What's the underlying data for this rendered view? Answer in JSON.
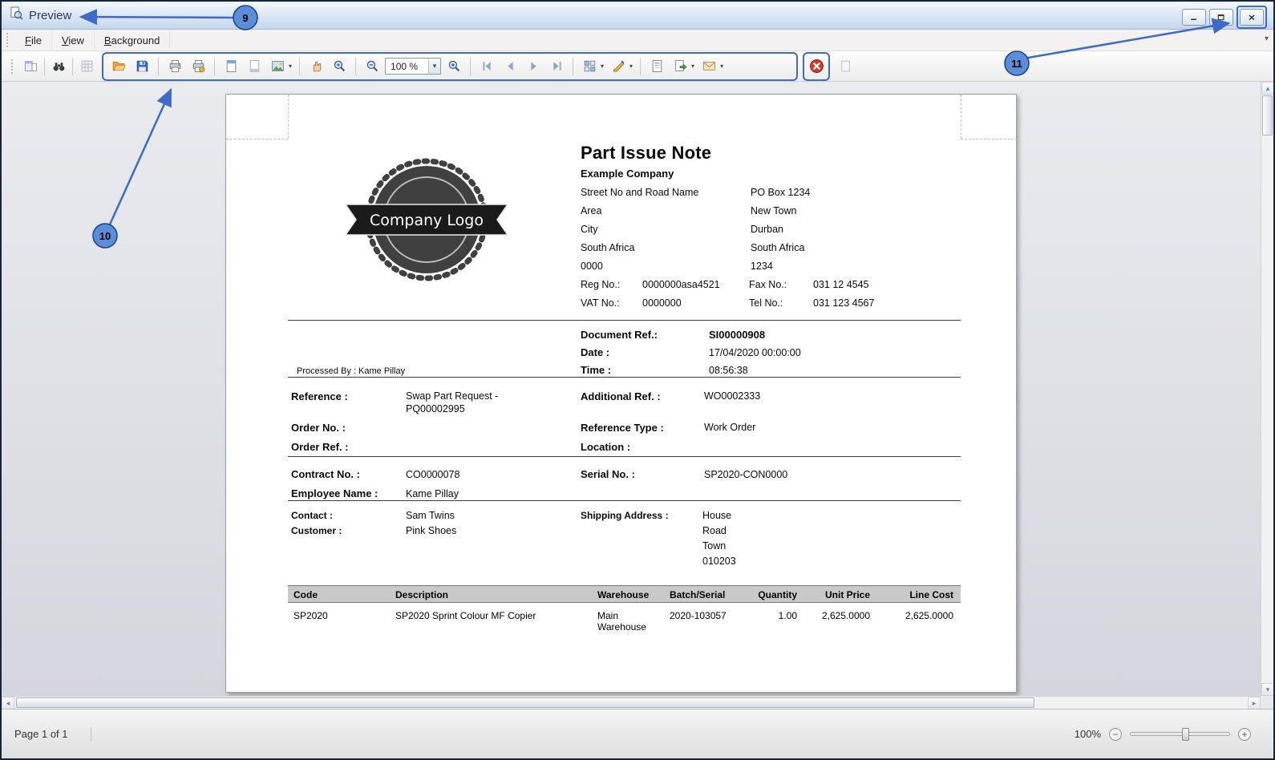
{
  "window": {
    "title": "Preview"
  },
  "menu": {
    "items": [
      "File",
      "View",
      "Background"
    ]
  },
  "toolbar": {
    "zoom_value": "100 %",
    "icons": [
      "dock-panels",
      "find",
      "grid",
      "open",
      "save",
      "print",
      "print-direct",
      "page-header",
      "page-footer",
      "scale-picture",
      "hand-tool",
      "zoom-tool",
      "zoom-out",
      "zoom-in",
      "first-page",
      "previous-page",
      "next-page",
      "last-page",
      "multiple-pages",
      "watermark",
      "document-map",
      "export",
      "email",
      "close-preview"
    ]
  },
  "annotations": {
    "callout_9": "9",
    "callout_10": "10",
    "callout_11": "11"
  },
  "colors": {
    "annotation_blue": "#3d6bc6",
    "close_red": "#d23a2e"
  },
  "statusbar": {
    "page_info": "Page 1 of 1",
    "zoom_label": "100%"
  },
  "doc": {
    "title": "Part Issue Note",
    "logo_text": "Company Logo",
    "company_name": "Example Company",
    "address_left": [
      "Street No and Road Name",
      "Area",
      "City",
      "South Africa",
      "0000"
    ],
    "address_right": [
      "PO Box 1234",
      "New Town",
      "Durban",
      "South Africa",
      "1234"
    ],
    "reg_label": "Reg No.:",
    "reg_value": "0000000asa4521",
    "fax_label": "Fax No.:",
    "fax_value": "031 12 4545",
    "vat_label": "VAT No.:",
    "vat_value": "0000000",
    "tel_label": "Tel No.:",
    "tel_value": "031 123 4567",
    "doc_ref_label": "Document Ref.:",
    "doc_ref_value": "SI00000908",
    "date_label": "Date :",
    "date_value": "17/04/2020 00:00:00",
    "time_label": "Time :",
    "time_value": "08:56:38",
    "processed_by": "Processed By : Kame Pillay",
    "reference_label": "Reference :",
    "reference_value_1": "Swap Part Request -",
    "reference_value_2": "PQ00002995",
    "additional_ref_label": "Additional Ref. :",
    "additional_ref_value": "WO0002333",
    "order_no_label": "Order No. :",
    "reference_type_label": "Reference Type :",
    "reference_type_value": "Work Order",
    "order_ref_label": "Order Ref. :",
    "location_label": "Location :",
    "contract_no_label": "Contract No. :",
    "contract_no_value": "CO0000078",
    "serial_no_label": "Serial No. :",
    "serial_no_value": "SP2020-CON0000",
    "employee_label": "Employee Name :",
    "employee_value": "Kame Pillay",
    "contact_label": "Contact :",
    "contact_value": "Sam Twins",
    "customer_label": "Customer :",
    "customer_value": "Pink Shoes",
    "shipping_label": "Shipping Address :",
    "shipping_lines": [
      "House",
      "Road",
      "Town",
      "010203"
    ],
    "table": {
      "headers": [
        "Code",
        "Description",
        "Warehouse",
        "Batch/Serial",
        "Quantity",
        "Unit Price",
        "Line Cost"
      ],
      "rows": [
        [
          "SP2020",
          "SP2020 Sprint Colour MF Copier",
          "Main Warehouse",
          "2020-103057",
          "1.00",
          "2,625.0000",
          "2,625.0000"
        ]
      ]
    }
  }
}
